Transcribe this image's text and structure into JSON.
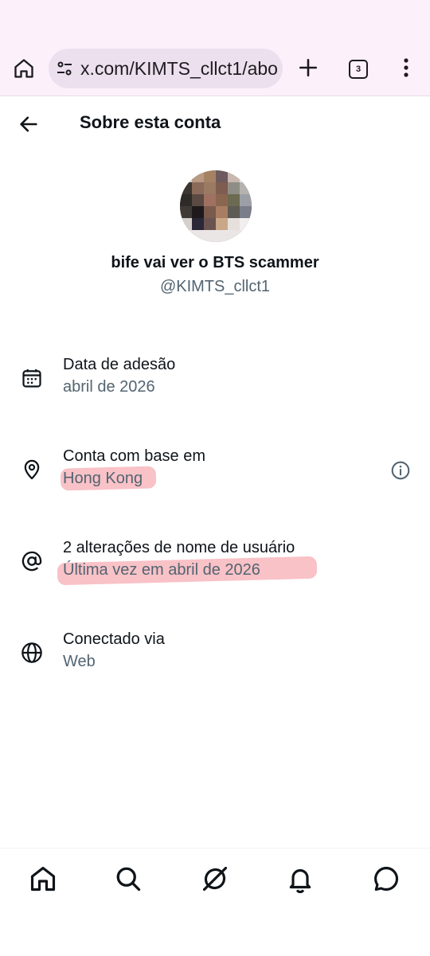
{
  "browser": {
    "url": "x.com/KIMTS_cllct1/abo",
    "tab_count": "3"
  },
  "header": {
    "title": "Sobre esta conta"
  },
  "profile": {
    "display_name": "bife vai ver o BTS scammer",
    "handle": "@KIMTS_cllct1"
  },
  "rows": [
    {
      "icon": "calendar-icon",
      "title": "Data de adesão",
      "subtitle": "abril de 2026"
    },
    {
      "icon": "location-pin-icon",
      "title": "Conta com base em",
      "subtitle": "Hong Kong",
      "trailing_icon": "info-icon"
    },
    {
      "icon": "at-sign-icon",
      "title": "2 alterações de nome de usuário",
      "subtitle": "Última vez em abril de 2026"
    },
    {
      "icon": "globe-icon",
      "title": "Conectado via",
      "subtitle": "Web"
    }
  ],
  "bottom_nav": {
    "items": [
      "home-icon",
      "search-icon",
      "grok-icon",
      "notifications-icon",
      "messages-icon"
    ]
  },
  "colors": {
    "text_primary": "#0f1419",
    "text_secondary": "#536471",
    "browser_bar": "#fcf1fb",
    "highlight": "#f07882"
  }
}
